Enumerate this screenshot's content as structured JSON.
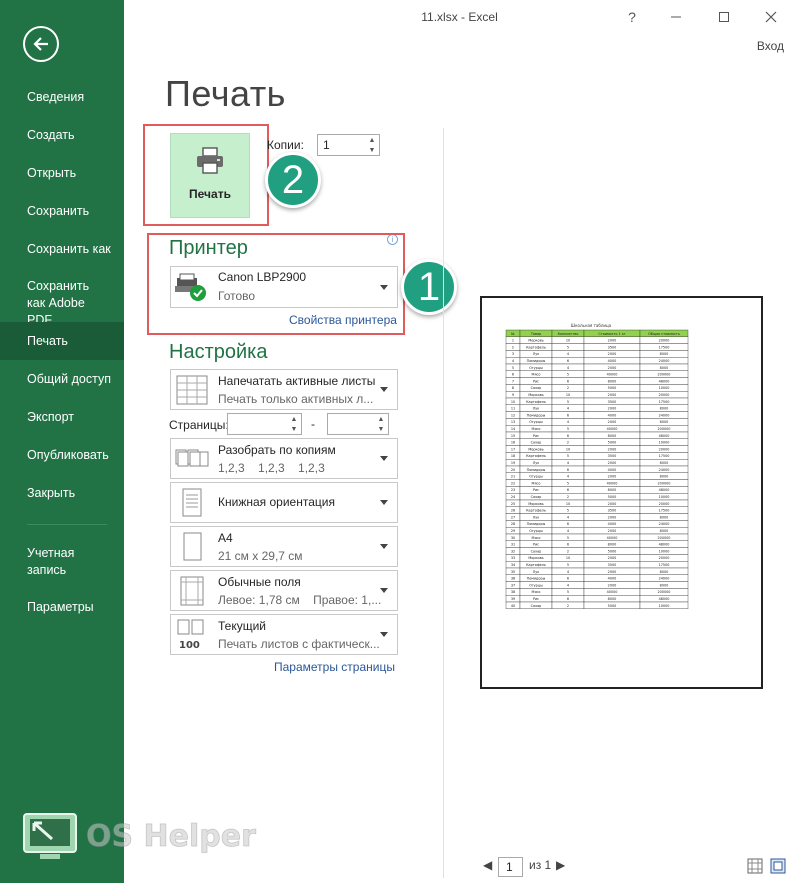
{
  "window": {
    "title": "11.xlsx - Excel",
    "help": "?",
    "signin": "Вход"
  },
  "sidebar": {
    "items": [
      {
        "label": "Сведения"
      },
      {
        "label": "Создать"
      },
      {
        "label": "Открыть"
      },
      {
        "label": "Сохранить"
      },
      {
        "label": "Сохранить как"
      },
      {
        "label": "Сохранить как Adobe PDF"
      },
      {
        "label": "Печать"
      },
      {
        "label": "Общий доступ"
      },
      {
        "label": "Экспорт"
      },
      {
        "label": "Опубликовать"
      },
      {
        "label": "Закрыть"
      },
      {
        "label": "Учетная запись"
      },
      {
        "label": "Параметры"
      }
    ],
    "logo_text": "OS Helper"
  },
  "page": {
    "heading": "Печать"
  },
  "print": {
    "button_label": "Печать",
    "copies_label": "Копии:",
    "copies_value": "1"
  },
  "badges": {
    "one": "1",
    "two": "2"
  },
  "printer": {
    "heading": "Принтер",
    "name": "Canon LBP2900",
    "status": "Готово",
    "properties_link": "Свойства принтера"
  },
  "settings": {
    "heading": "Настройка",
    "scope": {
      "title": "Напечатать активные листы",
      "subtitle": "Печать только активных л..."
    },
    "pages_label": "Страницы:",
    "pages_dash": "-",
    "collate": {
      "title": "Разобрать по копиям",
      "subtitle": "1,2,3    1,2,3    1,2,3"
    },
    "orientation": {
      "title": "Книжная ориентация"
    },
    "paper": {
      "title": "A4",
      "subtitle": "21 см x 29,7 см"
    },
    "margins": {
      "title": "Обычные поля",
      "subtitle": "Левое: 1,78 см    Правое: 1,..."
    },
    "scaling": {
      "title": "Текущий",
      "subtitle": "Печать листов с фактическ...",
      "icon_text": "100"
    },
    "page_setup_link": "Параметры страницы"
  },
  "preview": {
    "sheet_title": "Школьная таблица",
    "headers": [
      "№",
      "Товар",
      "Количество",
      "Стоимость 1 кг",
      "Общая стоимость"
    ],
    "rows": [
      [
        "1",
        "Морковь",
        "10",
        "2000",
        "20000"
      ],
      [
        "2",
        "Картофель",
        "5",
        "3500",
        "17500"
      ],
      [
        "3",
        "Лук",
        "4",
        "2000",
        "8000"
      ],
      [
        "4",
        "Помидоры",
        "6",
        "4000",
        "24000"
      ],
      [
        "5",
        "Огурцы",
        "4",
        "2000",
        "8000"
      ],
      [
        "6",
        "Мясо",
        "5",
        "40000",
        "200000"
      ],
      [
        "7",
        "Рис",
        "6",
        "8000",
        "48000"
      ],
      [
        "8",
        "Сахар",
        "2",
        "5000",
        "10000"
      ],
      [
        "9",
        "Морковь",
        "10",
        "2000",
        "20000"
      ],
      [
        "10",
        "Картофель",
        "5",
        "3500",
        "17500"
      ],
      [
        "11",
        "Лук",
        "4",
        "2000",
        "8000"
      ],
      [
        "12",
        "Помидоры",
        "6",
        "4000",
        "24000"
      ],
      [
        "13",
        "Огурцы",
        "4",
        "2000",
        "8000"
      ],
      [
        "14",
        "Мясо",
        "5",
        "40000",
        "200000"
      ],
      [
        "15",
        "Рис",
        "6",
        "8000",
        "48000"
      ],
      [
        "16",
        "Сахар",
        "2",
        "5000",
        "10000"
      ],
      [
        "17",
        "Морковь",
        "10",
        "2000",
        "20000"
      ],
      [
        "18",
        "Картофель",
        "5",
        "3500",
        "17500"
      ],
      [
        "19",
        "Лук",
        "4",
        "2000",
        "8000"
      ],
      [
        "20",
        "Помидоры",
        "6",
        "4000",
        "24000"
      ],
      [
        "21",
        "Огурцы",
        "4",
        "2000",
        "8000"
      ],
      [
        "22",
        "Мясо",
        "5",
        "40000",
        "200000"
      ],
      [
        "23",
        "Рис",
        "6",
        "8000",
        "48000"
      ],
      [
        "24",
        "Сахар",
        "2",
        "5000",
        "10000"
      ],
      [
        "25",
        "Морковь",
        "10",
        "2000",
        "20000"
      ],
      [
        "26",
        "Картофель",
        "5",
        "3500",
        "17500"
      ],
      [
        "27",
        "Лук",
        "4",
        "2000",
        "8000"
      ],
      [
        "28",
        "Помидоры",
        "6",
        "4000",
        "24000"
      ],
      [
        "29",
        "Огурцы",
        "4",
        "2000",
        "8000"
      ],
      [
        "30",
        "Мясо",
        "5",
        "40000",
        "200000"
      ],
      [
        "31",
        "Рис",
        "6",
        "8000",
        "48000"
      ],
      [
        "32",
        "Сахар",
        "2",
        "5000",
        "10000"
      ],
      [
        "33",
        "Морковь",
        "10",
        "2000",
        "20000"
      ],
      [
        "34",
        "Картофель",
        "5",
        "3500",
        "17500"
      ],
      [
        "35",
        "Лук",
        "4",
        "2000",
        "8000"
      ],
      [
        "36",
        "Помидоры",
        "6",
        "4000",
        "24000"
      ],
      [
        "37",
        "Огурцы",
        "4",
        "2000",
        "8000"
      ],
      [
        "38",
        "Мясо",
        "5",
        "40000",
        "200000"
      ],
      [
        "39",
        "Рис",
        "6",
        "8000",
        "48000"
      ],
      [
        "40",
        "Сахар",
        "2",
        "5000",
        "10000"
      ]
    ]
  },
  "pager": {
    "current": "1",
    "total_label": "из 1"
  },
  "colors": {
    "accent": "#217346",
    "print_button": "#c6efce",
    "highlight": "#e05b5b",
    "badge": "#20a080",
    "link": "#2b5797"
  }
}
